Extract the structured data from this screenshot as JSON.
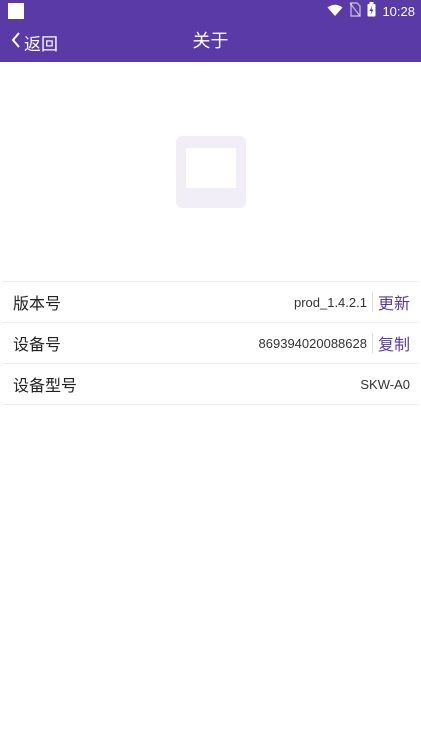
{
  "status_bar": {
    "time": "10:28",
    "icons": [
      "square-app-icon",
      "wifi-icon",
      "no-sim-icon",
      "battery-charging-icon"
    ]
  },
  "header": {
    "back_label": "返回",
    "title": "关于"
  },
  "about_list": [
    {
      "label": "版本号",
      "value": "prod_1.4.2.1",
      "action": "更新"
    },
    {
      "label": "设备号",
      "value": "869394020088628",
      "action": "复制"
    },
    {
      "label": "设备型号",
      "value": "SKW-A0"
    }
  ],
  "colors": {
    "primary": "#5a3aa6",
    "background": "#ffffff",
    "divider": "#ececec"
  }
}
